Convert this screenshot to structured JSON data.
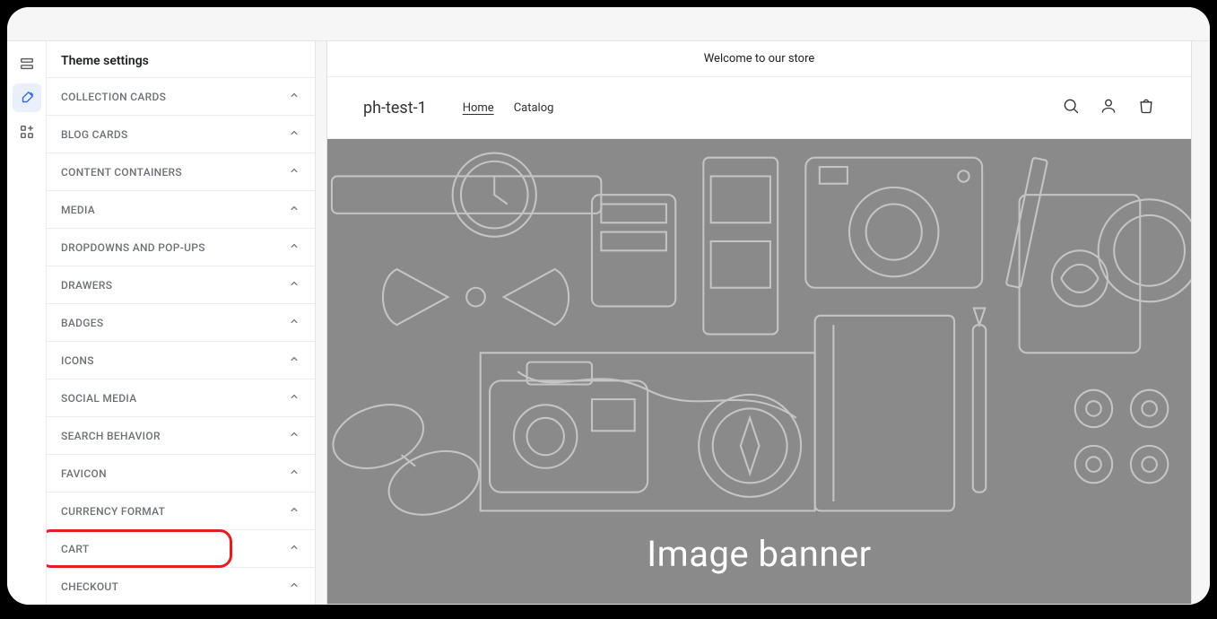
{
  "sidebar": {
    "title": "Theme settings",
    "items": [
      {
        "label": "COLLECTION CARDS",
        "highlighted": false
      },
      {
        "label": "BLOG CARDS",
        "highlighted": false
      },
      {
        "label": "CONTENT CONTAINERS",
        "highlighted": false
      },
      {
        "label": "MEDIA",
        "highlighted": false
      },
      {
        "label": "DROPDOWNS AND POP-UPS",
        "highlighted": false
      },
      {
        "label": "DRAWERS",
        "highlighted": false
      },
      {
        "label": "BADGES",
        "highlighted": false
      },
      {
        "label": "ICONS",
        "highlighted": false
      },
      {
        "label": "SOCIAL MEDIA",
        "highlighted": false
      },
      {
        "label": "SEARCH BEHAVIOR",
        "highlighted": false
      },
      {
        "label": "FAVICON",
        "highlighted": false
      },
      {
        "label": "CURRENCY FORMAT",
        "highlighted": false
      },
      {
        "label": "CART",
        "highlighted": true
      },
      {
        "label": "CHECKOUT",
        "highlighted": false
      }
    ]
  },
  "rail": {
    "items": [
      {
        "name": "sections"
      },
      {
        "name": "theme-settings",
        "active": true
      },
      {
        "name": "apps"
      }
    ]
  },
  "preview": {
    "announcement": "Welcome to our store",
    "store_name": "ph-test-1",
    "nav": [
      {
        "label": "Home",
        "active": true
      },
      {
        "label": "Catalog",
        "active": false
      }
    ],
    "banner_text": "Image banner"
  }
}
